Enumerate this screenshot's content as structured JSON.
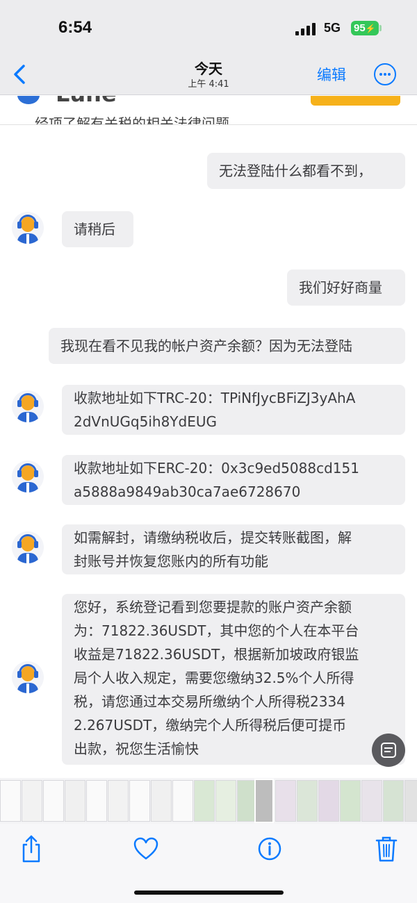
{
  "status_bar": {
    "time": "6:54",
    "network": "5G",
    "battery": "95"
  },
  "nav": {
    "title": "今天",
    "subtitle": "上午 4:41",
    "edit_label": "编辑"
  },
  "header_peek": {
    "brand": "Lune",
    "text": "经项了解有关税的相关法律问题"
  },
  "messages": [
    {
      "side": "right",
      "text": "无法登陆什么都看不到，"
    },
    {
      "side": "left",
      "text": "请稍后"
    },
    {
      "side": "right",
      "text": "我们好好商量"
    },
    {
      "side": "right",
      "text": "我现在看不见我的帐户资产余额？因为无法登陆"
    },
    {
      "side": "left",
      "lines": [
        "收款地址如下TRC-20：TPiNfJycBFiZJ3yAhA",
        "2dVnUGq5ih8YdEUG"
      ]
    },
    {
      "side": "left",
      "lines": [
        "收款地址如下ERC-20：0x3c9ed5088cd151",
        "a5888a9849ab30ca7ae6728670"
      ]
    },
    {
      "side": "left",
      "lines": [
        "如需解封，请缴纳税收后，提交转账截图，解",
        "封账号并恢复您账内的所有功能"
      ]
    },
    {
      "side": "left",
      "lines": [
        "您好，系统登记看到您要提款的账户资产余额",
        "为：71822.36USDT，其中您的个人在本平台",
        "收益是71822.36USDT，根据新加坡政府银监",
        "局个人收入规定，需要您缴纳32.5%个人所得",
        "税，请您通过本交易所缴纳个人所得税2334",
        "2.267USDT，缴纳完个人所得税后便可提币",
        "出款，祝您生活愉快"
      ]
    }
  ],
  "icons": {
    "back": "chevron-left-icon",
    "more": "ellipsis-circle-icon",
    "ocr": "live-text-icon",
    "share": "share-icon",
    "favorite": "heart-icon",
    "info": "info-icon",
    "delete": "trash-icon",
    "avatar": "support-agent-avatar"
  },
  "colors": {
    "accent": "#0a7aff",
    "bubble": "#efeff1",
    "battery": "#34c759",
    "header_button": "#f6b11a"
  }
}
